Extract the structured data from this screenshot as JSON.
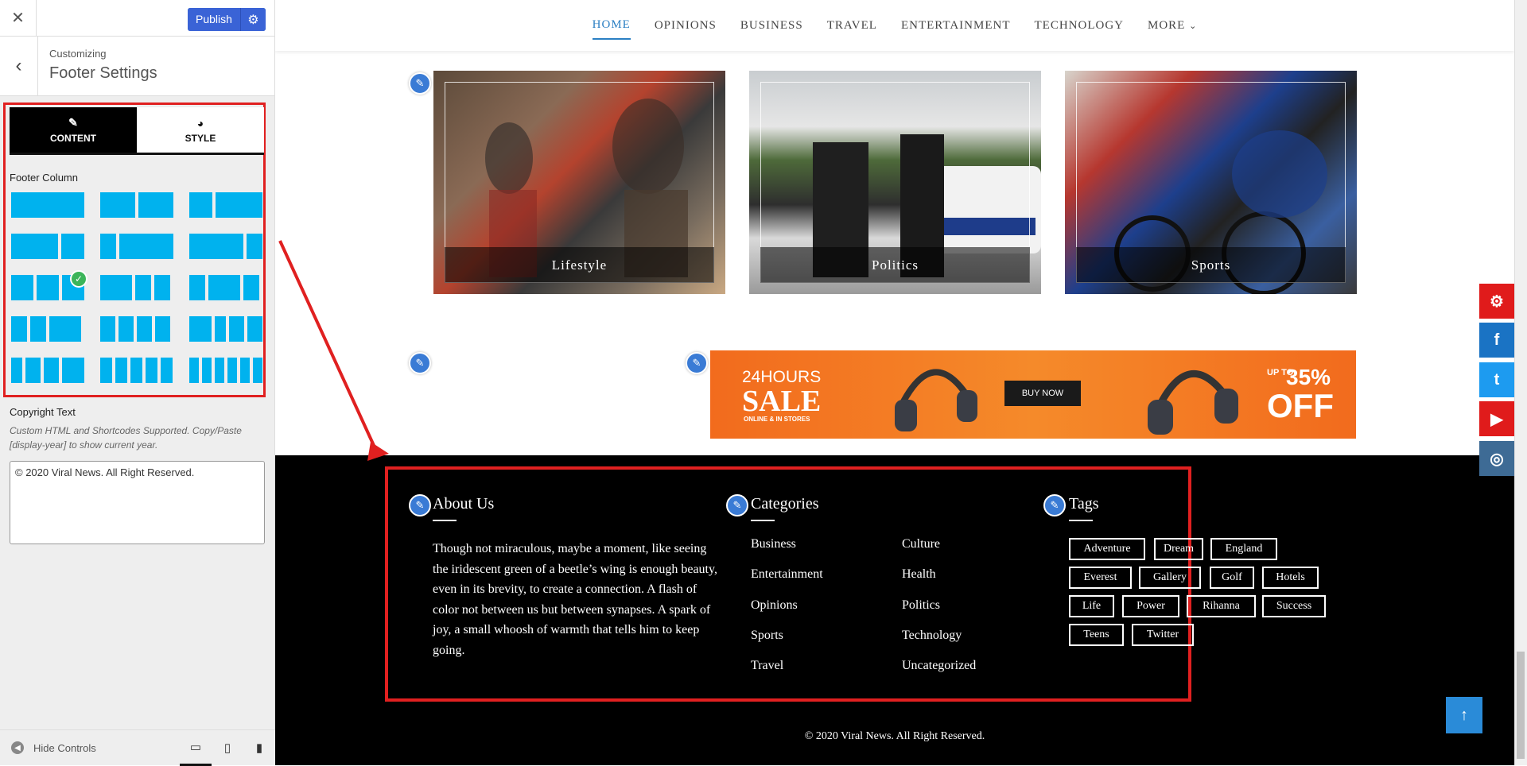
{
  "sidebar": {
    "close_icon": "close-icon",
    "publish_label": "Publish",
    "crumb_small": "Customizing",
    "crumb_title": "Footer Settings",
    "tabs": [
      {
        "label": "CONTENT",
        "icon": "edit-icon"
      },
      {
        "label": "STYLE",
        "icon": "palette-icon"
      }
    ],
    "footer_column_label": "Footer Column",
    "copyright_label": "Copyright Text",
    "copyright_help": "Custom HTML and Shortcodes Supported. Copy/Paste [display-year] to show current year.",
    "copyright_value": "© 2020 Viral News. All Right Reserved.",
    "hide_controls": "Hide Controls",
    "selected_layout": 7
  },
  "nav": {
    "items": [
      "HOME",
      "OPINIONS",
      "BUSINESS",
      "TRAVEL",
      "ENTERTAINMENT",
      "TECHNOLOGY",
      "MORE"
    ],
    "active": "HOME"
  },
  "categories": [
    {
      "label": "Lifestyle"
    },
    {
      "label": "Politics"
    },
    {
      "label": "Sports"
    }
  ],
  "ad": {
    "line1": "24HOURS",
    "line2": "SALE",
    "line3": "ONLINE & IN STORES",
    "button": "BUY NOW",
    "upto": "UP TO",
    "percent": "35%",
    "off": "OFF"
  },
  "footer": {
    "about_title": "About Us",
    "about_text": "Though not miraculous, maybe a moment, like seeing the iridescent green of a beetle’s wing is enough beauty, even in its brevity, to create a connection. A flash of color not between us but between synapses. A spark of joy, a small whoosh of warmth that tells him to keep going.",
    "categories_title": "Categories",
    "categories_col1": [
      "Business",
      "Entertainment",
      "Opinions",
      "Sports",
      "Travel"
    ],
    "categories_col2": [
      "Culture",
      "Health",
      "Politics",
      "Technology",
      "Uncategorized"
    ],
    "tags_title": "Tags",
    "tags": [
      "Adventure",
      "Dream",
      "England",
      "Everest",
      "Gallery",
      "Golf",
      "Hotels",
      "Life",
      "Power",
      "Rihanna",
      "Success",
      "Teens",
      "Twitter"
    ],
    "copyright": "© 2020 Viral News. All Right Reserved."
  },
  "social": [
    "settings-icon",
    "facebook-icon",
    "twitter-icon",
    "youtube-icon",
    "instagram-icon"
  ],
  "colors": {
    "accent": "#2b7fc3",
    "layout_block": "#00b2ee",
    "highlight": "#e02020",
    "footer_bg": "#000000"
  }
}
